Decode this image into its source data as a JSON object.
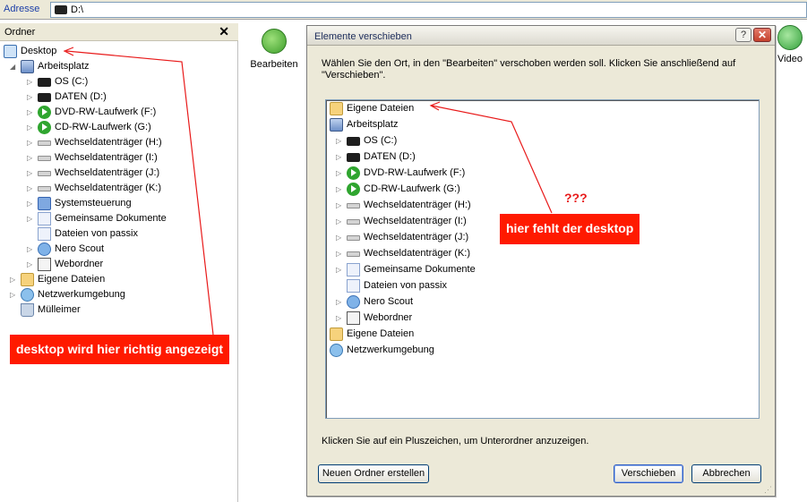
{
  "address_bar": {
    "label": "Adresse",
    "path": "D:\\"
  },
  "folders_panel": {
    "title": "Ordner",
    "close_glyph": "✕",
    "items": [
      {
        "label": "Desktop",
        "icon": "desktop-icon",
        "toggle": ""
      },
      {
        "label": "Arbeitsplatz",
        "icon": "computer-icon",
        "toggle": "◢"
      },
      {
        "label": "OS (C:)",
        "icon": "drive-icon",
        "toggle": "▷"
      },
      {
        "label": "DATEN (D:)",
        "icon": "drive-icon",
        "toggle": "▷"
      },
      {
        "label": "DVD-RW-Laufwerk (F:)",
        "icon": "dvd-drive-icon",
        "toggle": "▷"
      },
      {
        "label": "CD-RW-Laufwerk (G:)",
        "icon": "cd-drive-icon",
        "toggle": "▷"
      },
      {
        "label": "Wechseldatenträger (H:)",
        "icon": "removable-drive-icon",
        "toggle": "▷"
      },
      {
        "label": "Wechseldatenträger (I:)",
        "icon": "removable-drive-icon",
        "toggle": "▷"
      },
      {
        "label": "Wechseldatenträger (J:)",
        "icon": "removable-drive-icon",
        "toggle": "▷"
      },
      {
        "label": "Wechseldatenträger (K:)",
        "icon": "removable-drive-icon",
        "toggle": "▷"
      },
      {
        "label": "Systemsteuerung",
        "icon": "control-panel-icon",
        "toggle": "▷"
      },
      {
        "label": "Gemeinsame Dokumente",
        "icon": "shared-documents-icon",
        "toggle": "▷"
      },
      {
        "label": "Dateien von passix",
        "icon": "user-documents-icon",
        "toggle": ""
      },
      {
        "label": "Nero Scout",
        "icon": "nero-scout-icon",
        "toggle": "▷"
      },
      {
        "label": "Webordner",
        "icon": "web-folder-icon",
        "toggle": "▷"
      },
      {
        "label": "Eigene Dateien",
        "icon": "my-documents-icon",
        "toggle": "▷"
      },
      {
        "label": "Netzwerkumgebung",
        "icon": "network-icon",
        "toggle": "▷"
      },
      {
        "label": "Mülleimer",
        "icon": "recycle-bin-icon",
        "toggle": ""
      }
    ]
  },
  "toolbar": {
    "edit_label": "Bearbeiten",
    "video_label": "Video"
  },
  "dialog": {
    "title": "Elemente verschieben",
    "help_glyph": "?",
    "close_glyph": "✕",
    "instruction": "Wählen Sie den Ort, in den \"Bearbeiten\" verschoben werden soll. Klicken Sie anschließend auf \"Verschieben\".",
    "tree": [
      {
        "label": "Eigene Dateien",
        "icon": "my-documents-icon",
        "toggle": ""
      },
      {
        "label": "Arbeitsplatz",
        "icon": "computer-icon",
        "toggle": ""
      },
      {
        "label": "OS (C:)",
        "icon": "drive-icon",
        "toggle": "▷"
      },
      {
        "label": "DATEN (D:)",
        "icon": "drive-icon",
        "toggle": "▷"
      },
      {
        "label": "DVD-RW-Laufwerk (F:)",
        "icon": "dvd-drive-icon",
        "toggle": "▷"
      },
      {
        "label": "CD-RW-Laufwerk (G:)",
        "icon": "cd-drive-icon",
        "toggle": "▷"
      },
      {
        "label": "Wechseldatenträger (H:)",
        "icon": "removable-drive-icon",
        "toggle": "▷"
      },
      {
        "label": "Wechseldatenträger (I:)",
        "icon": "removable-drive-icon",
        "toggle": "▷"
      },
      {
        "label": "Wechseldatenträger (J:)",
        "icon": "removable-drive-icon",
        "toggle": "▷"
      },
      {
        "label": "Wechseldatenträger (K:)",
        "icon": "removable-drive-icon",
        "toggle": "▷"
      },
      {
        "label": "Gemeinsame Dokumente",
        "icon": "shared-documents-icon",
        "toggle": "▷"
      },
      {
        "label": "Dateien von passix",
        "icon": "user-documents-icon",
        "toggle": ""
      },
      {
        "label": "Nero Scout",
        "icon": "nero-scout-icon",
        "toggle": "▷"
      },
      {
        "label": "Webordner",
        "icon": "web-folder-icon",
        "toggle": "▷"
      },
      {
        "label": "Eigene Dateien",
        "icon": "my-documents-icon",
        "toggle": ""
      },
      {
        "label": "Netzwerkumgebung",
        "icon": "network-icon",
        "toggle": ""
      }
    ],
    "hint": "Klicken Sie auf ein Pluszeichen, um Unterordner anzuzeigen.",
    "new_folder_button": "Neuen Ordner erstellen",
    "move_button": "Verschieben",
    "cancel_button": "Abbrechen"
  },
  "annotations": {
    "left_note": "desktop wird hier richtig angezeigt",
    "question": "???",
    "right_note": "hier fehlt der desktop",
    "color": "#ff1a00"
  }
}
